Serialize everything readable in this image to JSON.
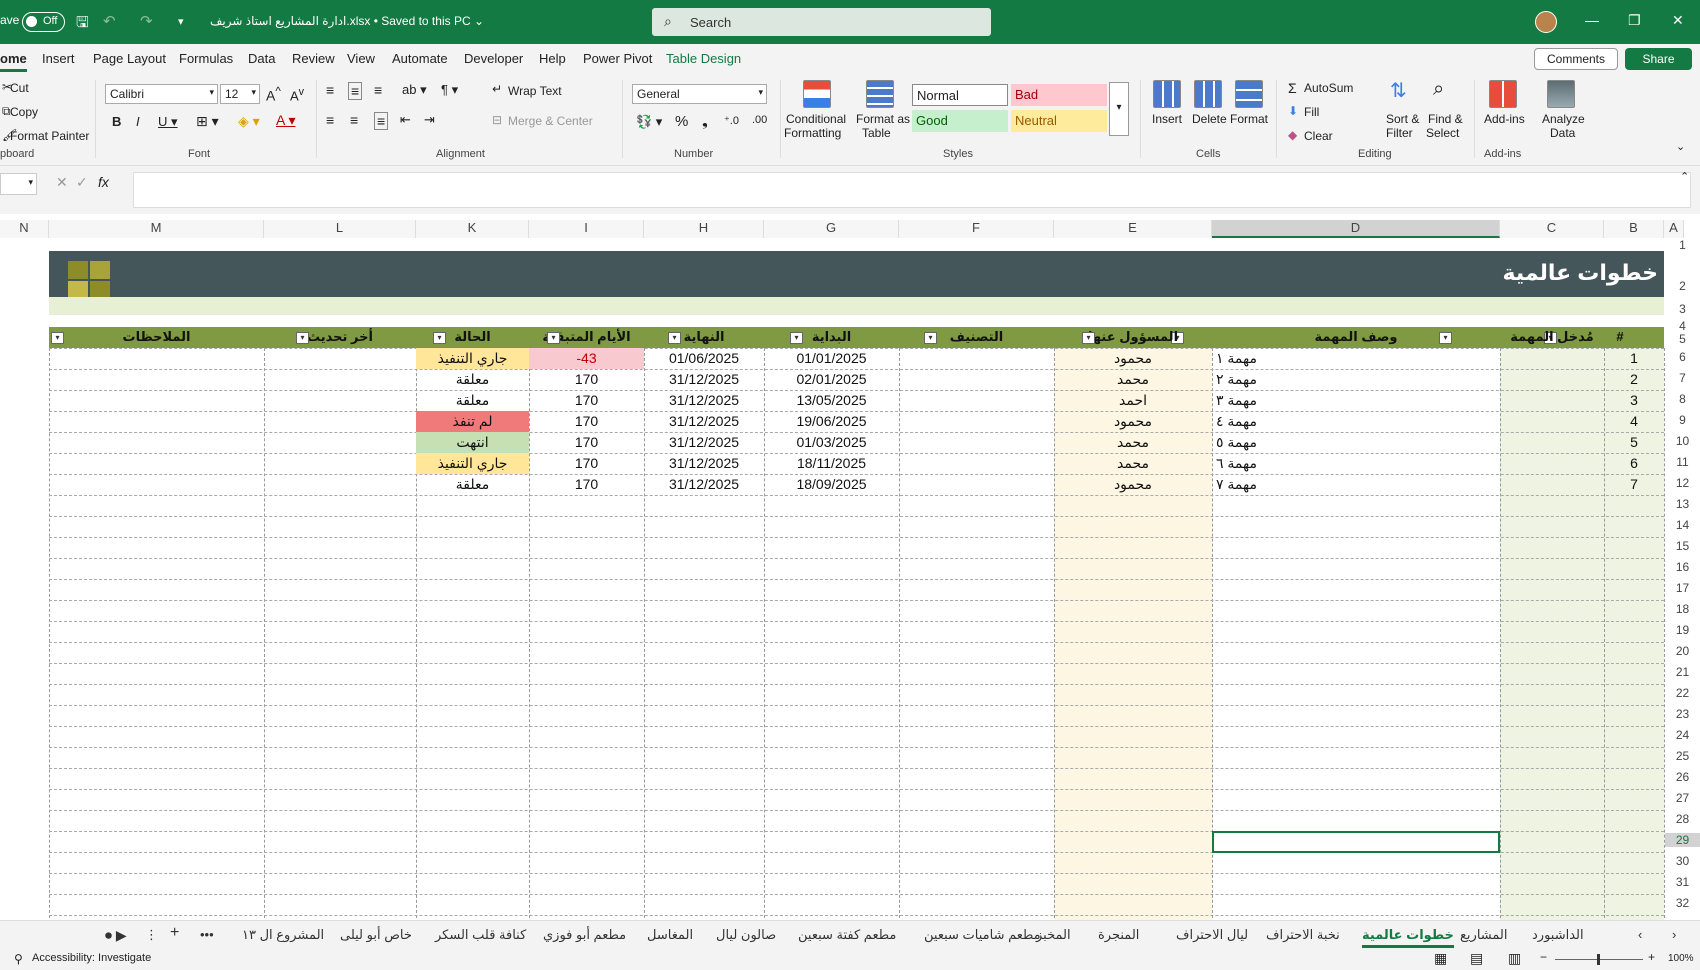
{
  "titlebar": {
    "autosave_label": "ave",
    "toggle_state": "Off",
    "doc_title": "ادارة المشاريع استاذ شريف.xlsx • Saved to this PC ⌄",
    "search_placeholder": "Search"
  },
  "menu": {
    "tabs": [
      "ome",
      "Insert",
      "Page Layout",
      "Formulas",
      "Data",
      "Review",
      "View",
      "Automate",
      "Developer",
      "Help",
      "Power Pivot",
      "Table Design"
    ],
    "comments": "Comments",
    "share": "Share"
  },
  "ribbon": {
    "clipboard": {
      "cut": "Cut",
      "copy": "Copy",
      "format_painter": "Format Painter",
      "label": "pboard"
    },
    "font": {
      "name": "Calibri",
      "size": "12",
      "label": "Font"
    },
    "alignment": {
      "wrap": "Wrap Text",
      "merge": "Merge & Center",
      "label": "Alignment"
    },
    "number": {
      "format": "General",
      "label": "Number"
    },
    "styles": {
      "cond": "Conditional",
      "cond2": "Formatting",
      "fmt_table": "Format as",
      "fmt_table2": "Table",
      "normal": "Normal",
      "bad": "Bad",
      "good": "Good",
      "neutral": "Neutral",
      "label": "Styles"
    },
    "cells": {
      "insert": "Insert",
      "delete": "Delete",
      "format": "Format",
      "label": "Cells"
    },
    "editing": {
      "autosum": "AutoSum",
      "fill": "Fill",
      "clear": "Clear",
      "sort": "Sort &",
      "sort2": "Filter",
      "find": "Find &",
      "find2": "Select",
      "label": "Editing"
    },
    "addins": {
      "addins": "Add-ins",
      "analyze": "Analyze",
      "analyze2": "Data",
      "label": "Add-ins"
    }
  },
  "formula": {
    "fx": "fx"
  },
  "columns": [
    "N",
    "M",
    "L",
    "K",
    "I",
    "H",
    "G",
    "F",
    "E",
    "D",
    "C",
    "B",
    "A"
  ],
  "rows": [
    "1",
    "2",
    "3",
    "4",
    "5",
    "6",
    "7",
    "8",
    "9",
    "10",
    "11",
    "12",
    "13",
    "14",
    "15",
    "16",
    "17",
    "18",
    "19",
    "20",
    "21",
    "22",
    "23",
    "24",
    "25",
    "26",
    "27",
    "28",
    "29",
    "30",
    "31",
    "32"
  ],
  "sheet": {
    "title": "خطوات عالمية",
    "headers": {
      "num": "#",
      "entry": "مُدخل المهمة",
      "desc": "وصف المهمة",
      "owner": "المسؤول عنها",
      "class": "التصنيف",
      "start": "البداية",
      "end": "النهاية",
      "remaining": "الأيام المتبقية",
      "status": "الحالة",
      "updated": "أخر تحديث",
      "notes": "الملاحظات"
    },
    "tasks": [
      {
        "num": "1",
        "desc": "مهمة ١",
        "owner": "محمود",
        "start": "01/01/2025",
        "end": "01/06/2025",
        "remaining": "-43",
        "status": "جاري التنفيذ",
        "status_color": "#ffe699",
        "rem_color": "#f8c9cf"
      },
      {
        "num": "2",
        "desc": "مهمة ٢",
        "owner": "محمد",
        "start": "02/01/2025",
        "end": "31/12/2025",
        "remaining": "170",
        "status": "معلقة",
        "status_color": "",
        "rem_color": ""
      },
      {
        "num": "3",
        "desc": "مهمة ٣",
        "owner": "احمد",
        "start": "13/05/2025",
        "end": "31/12/2025",
        "remaining": "170",
        "status": "معلقة",
        "status_color": "",
        "rem_color": ""
      },
      {
        "num": "4",
        "desc": "مهمة ٤",
        "owner": "محمود",
        "start": "19/06/2025",
        "end": "31/12/2025",
        "remaining": "170",
        "status": "لم تنفذ",
        "status_color": "#f07a7a",
        "rem_color": ""
      },
      {
        "num": "5",
        "desc": "مهمة ٥",
        "owner": "محمد",
        "start": "01/03/2025",
        "end": "31/12/2025",
        "remaining": "170",
        "status": "انتهت",
        "status_color": "#c6e0b4",
        "rem_color": ""
      },
      {
        "num": "6",
        "desc": "مهمة ٦",
        "owner": "محمد",
        "start": "18/11/2025",
        "end": "31/12/2025",
        "remaining": "170",
        "status": "جاري التنفيذ",
        "status_color": "#ffe699",
        "rem_color": ""
      },
      {
        "num": "7",
        "desc": "مهمة ٧",
        "owner": "محمود",
        "start": "18/09/2025",
        "end": "31/12/2025",
        "remaining": "170",
        "status": "معلقة",
        "status_color": "",
        "rem_color": ""
      }
    ]
  },
  "sheet_tabs": [
    "الداشبورد",
    "المشاريع",
    "خطوات عالمية",
    "نخبة الاحتراف",
    "ليال الاحتراف",
    "المنجرة",
    "المخبز",
    "مطعم شاميات سبعين",
    "مطعم كفتة سبعين",
    "صالون ليال",
    "المغاسل",
    "مطعم أبو فوزي",
    "كنافة قلب السكر",
    "خاص أبو ليلى",
    "المشروع ال ١٣"
  ],
  "status": {
    "accessibility": "Accessibility: Investigate",
    "zoom": "100%"
  },
  "colors": {
    "accent": "#127a42",
    "banner": "#45565a",
    "header_row": "#7f9a42",
    "subbanner": "#e7efd4"
  }
}
